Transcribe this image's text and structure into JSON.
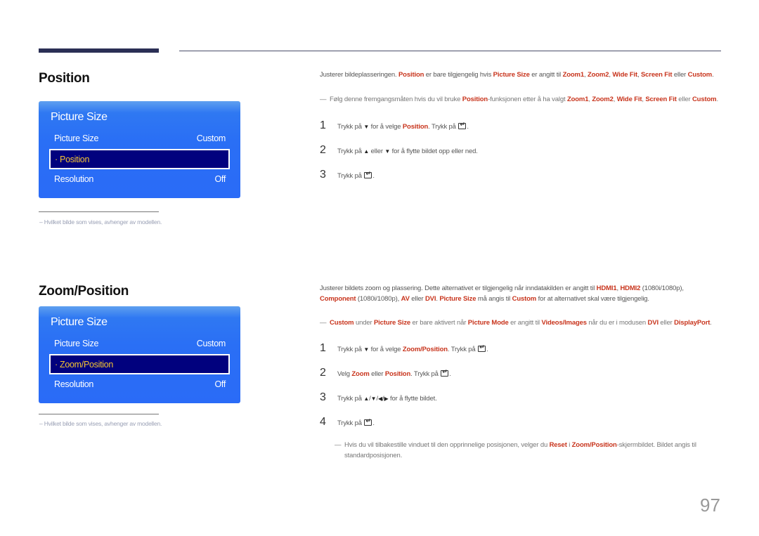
{
  "sections": [
    {
      "title": "Position",
      "osd": {
        "title": "Picture Size",
        "rows": [
          {
            "label": "Picture Size",
            "value": "Custom"
          },
          {
            "label": "· Position",
            "value": ""
          },
          {
            "label": "Resolution",
            "value": "Off"
          }
        ]
      },
      "footnote": "–  Hvilket bilde som vises, avhenger av modellen.",
      "description": [
        {
          "t": "Justerer bildeplasseringen. "
        },
        {
          "b": "Position"
        },
        {
          "t": " er bare tilgjengelig hvis "
        },
        {
          "b": "Picture Size"
        },
        {
          "t": " er angitt til "
        },
        {
          "b": "Zoom1"
        },
        {
          "t": ", "
        },
        {
          "b": "Zoom2"
        },
        {
          "t": ", "
        },
        {
          "b": "Wide Fit"
        },
        {
          "t": ", "
        },
        {
          "b": "Screen Fit"
        },
        {
          "t": " eller "
        },
        {
          "b": "Custom"
        },
        {
          "t": "."
        }
      ],
      "notes": [
        [
          {
            "t": "Følg denne fremgangsmåten hvis du vil bruke "
          },
          {
            "b": "Position"
          },
          {
            "t": "-funksjonen etter å ha valgt "
          },
          {
            "b": "Zoom1"
          },
          {
            "t": ", "
          },
          {
            "b": "Zoom2"
          },
          {
            "t": ", "
          },
          {
            "b": "Wide Fit"
          },
          {
            "t": ", "
          },
          {
            "b": "Screen Fit"
          },
          {
            "t": " eller "
          },
          {
            "b": "Custom"
          },
          {
            "t": "."
          }
        ]
      ],
      "steps": [
        {
          "num": "1",
          "parts": [
            {
              "t": "Trykk på "
            },
            {
              "i": "down"
            },
            {
              "t": " for å velge "
            },
            {
              "b": "Position"
            },
            {
              "t": ". Trykk på "
            },
            {
              "i": "enter"
            },
            {
              "t": "."
            }
          ]
        },
        {
          "num": "2",
          "parts": [
            {
              "t": "Trykk på "
            },
            {
              "i": "up"
            },
            {
              "t": " eller "
            },
            {
              "i": "down"
            },
            {
              "t": " for å flytte bildet opp eller ned."
            }
          ]
        },
        {
          "num": "3",
          "parts": [
            {
              "t": "Trykk på "
            },
            {
              "i": "enter"
            },
            {
              "t": "."
            }
          ]
        }
      ]
    },
    {
      "title": "Zoom/Position",
      "osd": {
        "title": "Picture Size",
        "rows": [
          {
            "label": "Picture Size",
            "value": "Custom"
          },
          {
            "label": "· Zoom/Position",
            "value": ""
          },
          {
            "label": "Resolution",
            "value": "Off"
          }
        ]
      },
      "footnote": "–  Hvilket bilde som vises, avhenger av modellen.",
      "description": [
        {
          "t": "Justerer bildets zoom og plassering. Dette alternativet er tilgjengelig når inndatakilden er angitt til "
        },
        {
          "b": "HDMI1"
        },
        {
          "t": ", "
        },
        {
          "b": "HDMI2"
        },
        {
          "t": " (1080i/1080p), "
        },
        {
          "b": "Component"
        },
        {
          "t": " (1080i/1080p), "
        },
        {
          "b": "AV"
        },
        {
          "t": " eller "
        },
        {
          "b": "DVI"
        },
        {
          "t": ". "
        },
        {
          "b": "Picture Size"
        },
        {
          "t": " må angis til "
        },
        {
          "b": "Custom"
        },
        {
          "t": " for at alternativet skal være tilgjengelig."
        }
      ],
      "notes": [
        [
          {
            "b": "Custom"
          },
          {
            "t": " under "
          },
          {
            "b": "Picture Size"
          },
          {
            "t": " er bare aktivert når "
          },
          {
            "b": "Picture Mode"
          },
          {
            "t": " er angitt til "
          },
          {
            "b": "Videos/Images"
          },
          {
            "t": " når du er i modusen "
          },
          {
            "b": "DVI"
          },
          {
            "t": " eller "
          },
          {
            "b": "DisplayPort"
          },
          {
            "t": "."
          }
        ]
      ],
      "steps": [
        {
          "num": "1",
          "parts": [
            {
              "t": "Trykk på "
            },
            {
              "i": "down"
            },
            {
              "t": " for å velge "
            },
            {
              "b": "Zoom/Position"
            },
            {
              "t": ". Trykk på "
            },
            {
              "i": "enter"
            },
            {
              "t": "."
            }
          ]
        },
        {
          "num": "2",
          "parts": [
            {
              "t": "Velg "
            },
            {
              "b": "Zoom"
            },
            {
              "t": " eller "
            },
            {
              "b": "Position"
            },
            {
              "t": ". Trykk på "
            },
            {
              "i": "enter"
            },
            {
              "t": "."
            }
          ]
        },
        {
          "num": "3",
          "parts": [
            {
              "t": "Trykk på "
            },
            {
              "i": "up"
            },
            {
              "t": "/"
            },
            {
              "i": "down"
            },
            {
              "t": "/"
            },
            {
              "i": "left"
            },
            {
              "t": "/"
            },
            {
              "i": "right"
            },
            {
              "t": " for å flytte bildet."
            }
          ]
        },
        {
          "num": "4",
          "parts": [
            {
              "t": "Trykk på "
            },
            {
              "i": "enter"
            },
            {
              "t": "."
            }
          ]
        }
      ],
      "final_note": [
        {
          "t": "Hvis du vil tilbakestille vinduet til den opprinnelige posisjonen, velger du "
        },
        {
          "b": "Reset"
        },
        {
          "t": " i "
        },
        {
          "b": "Zoom/Position"
        },
        {
          "t": "-skjermbildet. Bildet angis til standardposisjonen."
        }
      ]
    }
  ],
  "page_number": "97",
  "icons": {
    "down": "▼",
    "up": "▲",
    "left": "◀",
    "right": "▶",
    "enter": "enter-icon"
  },
  "colors": {
    "accent": "#c8341c",
    "osd_blue": "#2a6ff5",
    "osd_selected": "#01017e",
    "osd_selected_text": "#f5c431"
  }
}
